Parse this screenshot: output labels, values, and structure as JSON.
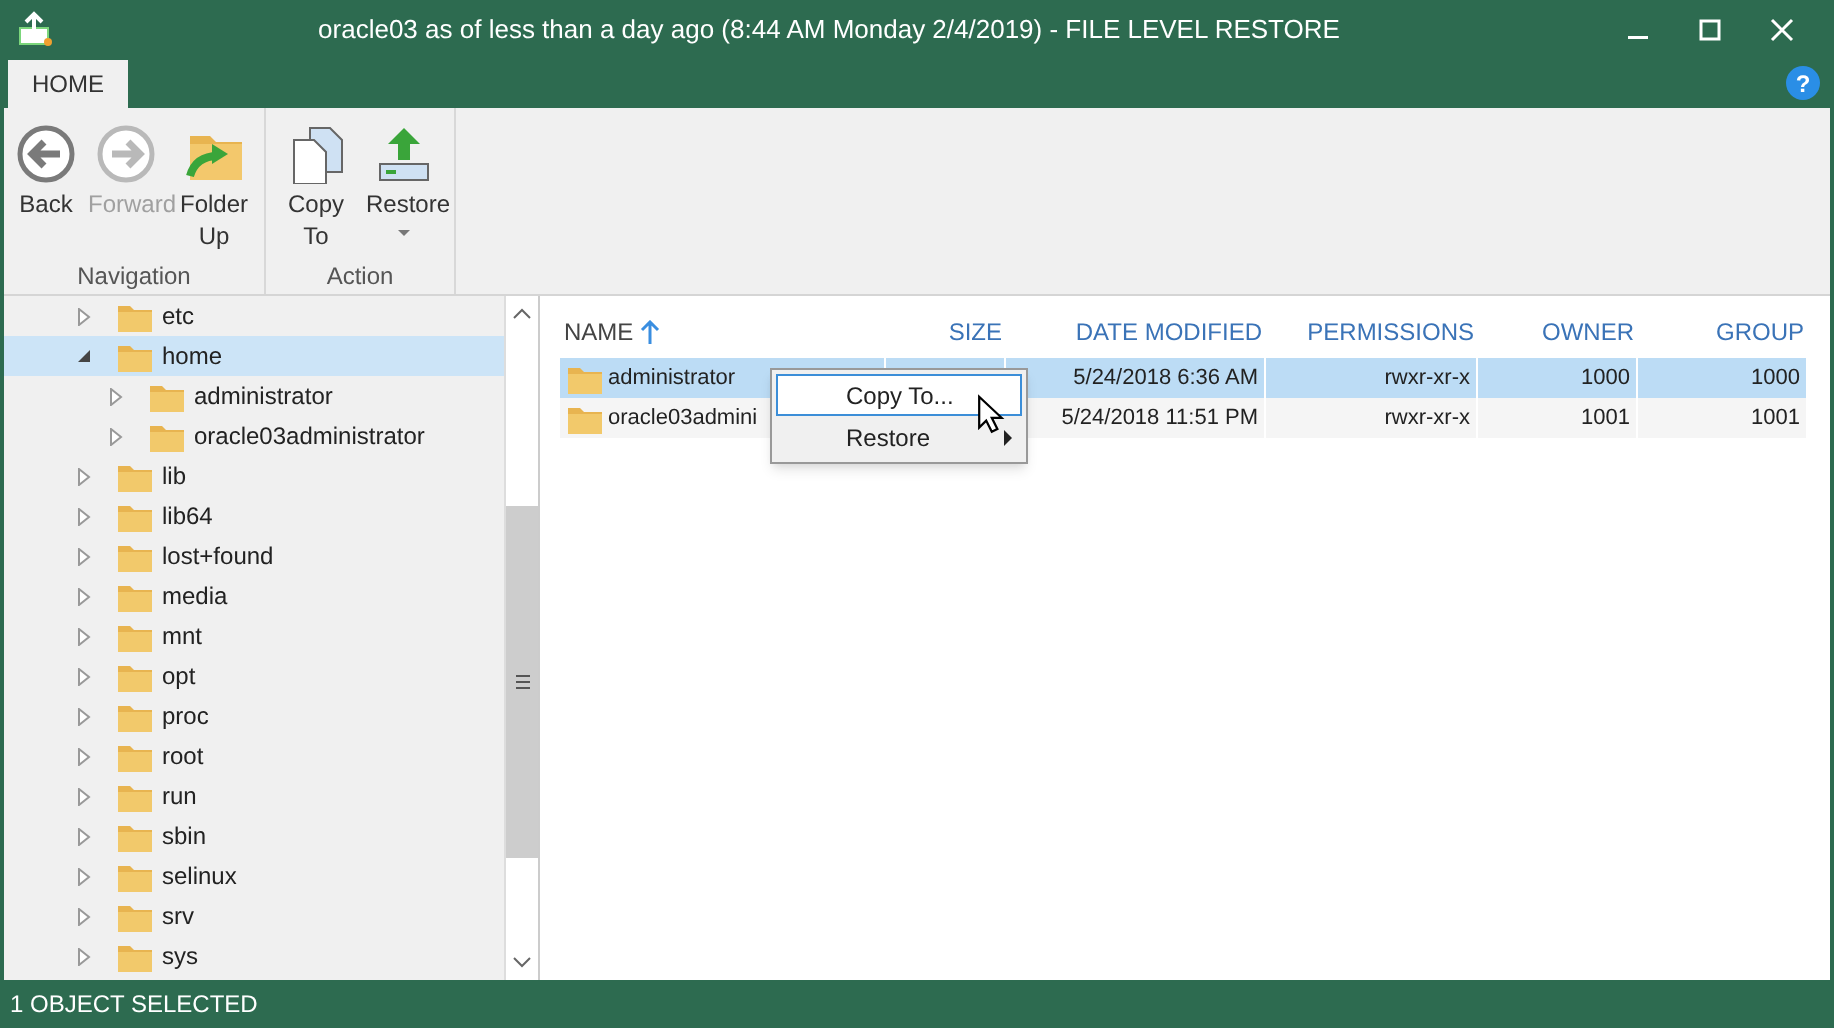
{
  "window": {
    "title": "oracle03 as of less than a day ago (8:44 AM Monday 2/4/2019) - FILE LEVEL RESTORE"
  },
  "tabs": [
    {
      "label": "HOME",
      "selected": true
    }
  ],
  "help": "?",
  "ribbon": {
    "groups": [
      {
        "label": "Navigation",
        "buttons": [
          {
            "kind": "back",
            "label": "Back",
            "disabled": false
          },
          {
            "kind": "forward",
            "label": "Forward",
            "disabled": true
          },
          {
            "kind": "folder-up",
            "label": "Folder Up",
            "disabled": false
          }
        ]
      },
      {
        "label": "Action",
        "buttons": [
          {
            "kind": "copy",
            "label": "Copy To",
            "disabled": false,
            "dropdown": false
          },
          {
            "kind": "restore",
            "label": "Restore",
            "disabled": false,
            "dropdown": true
          }
        ]
      }
    ]
  },
  "tree": [
    {
      "label": "etc",
      "expanded": false,
      "selected": false
    },
    {
      "label": "home",
      "expanded": true,
      "selected": true,
      "children": [
        {
          "label": "administrator",
          "expanded": false,
          "selected": false
        },
        {
          "label": "oracle03administrator",
          "expanded": false,
          "selected": false
        }
      ]
    },
    {
      "label": "lib",
      "expanded": false,
      "selected": false
    },
    {
      "label": "lib64",
      "expanded": false,
      "selected": false
    },
    {
      "label": "lost+found",
      "expanded": false,
      "selected": false
    },
    {
      "label": "media",
      "expanded": false,
      "selected": false
    },
    {
      "label": "mnt",
      "expanded": false,
      "selected": false
    },
    {
      "label": "opt",
      "expanded": false,
      "selected": false
    },
    {
      "label": "proc",
      "expanded": false,
      "selected": false
    },
    {
      "label": "root",
      "expanded": false,
      "selected": false
    },
    {
      "label": "run",
      "expanded": false,
      "selected": false
    },
    {
      "label": "sbin",
      "expanded": false,
      "selected": false
    },
    {
      "label": "selinux",
      "expanded": false,
      "selected": false
    },
    {
      "label": "srv",
      "expanded": false,
      "selected": false
    },
    {
      "label": "sys",
      "expanded": false,
      "selected": false
    }
  ],
  "table": {
    "columns": [
      {
        "label": "NAME",
        "sorted": true
      },
      {
        "label": "SIZE",
        "sorted": false
      },
      {
        "label": "DATE MODIFIED",
        "sorted": false
      },
      {
        "label": "PERMISSIONS",
        "sorted": false
      },
      {
        "label": "OWNER",
        "sorted": false
      },
      {
        "label": "GROUP",
        "sorted": false
      }
    ],
    "rows": [
      {
        "selected": true,
        "cells": [
          "administrator",
          "",
          "5/24/2018 6:36 AM",
          "rwxr-xr-x",
          "1000",
          "1000"
        ]
      },
      {
        "selected": false,
        "cells": [
          "oracle03admini",
          "",
          "5/24/2018 11:51 PM",
          "rwxr-xr-x",
          "1001",
          "1001"
        ]
      }
    ]
  },
  "context_menu": {
    "items": [
      {
        "label": "Copy To...",
        "selected": true,
        "submenu": false
      },
      {
        "label": "Restore",
        "selected": false,
        "submenu": true
      }
    ]
  },
  "status_bar": "1 OBJECT SELECTED"
}
